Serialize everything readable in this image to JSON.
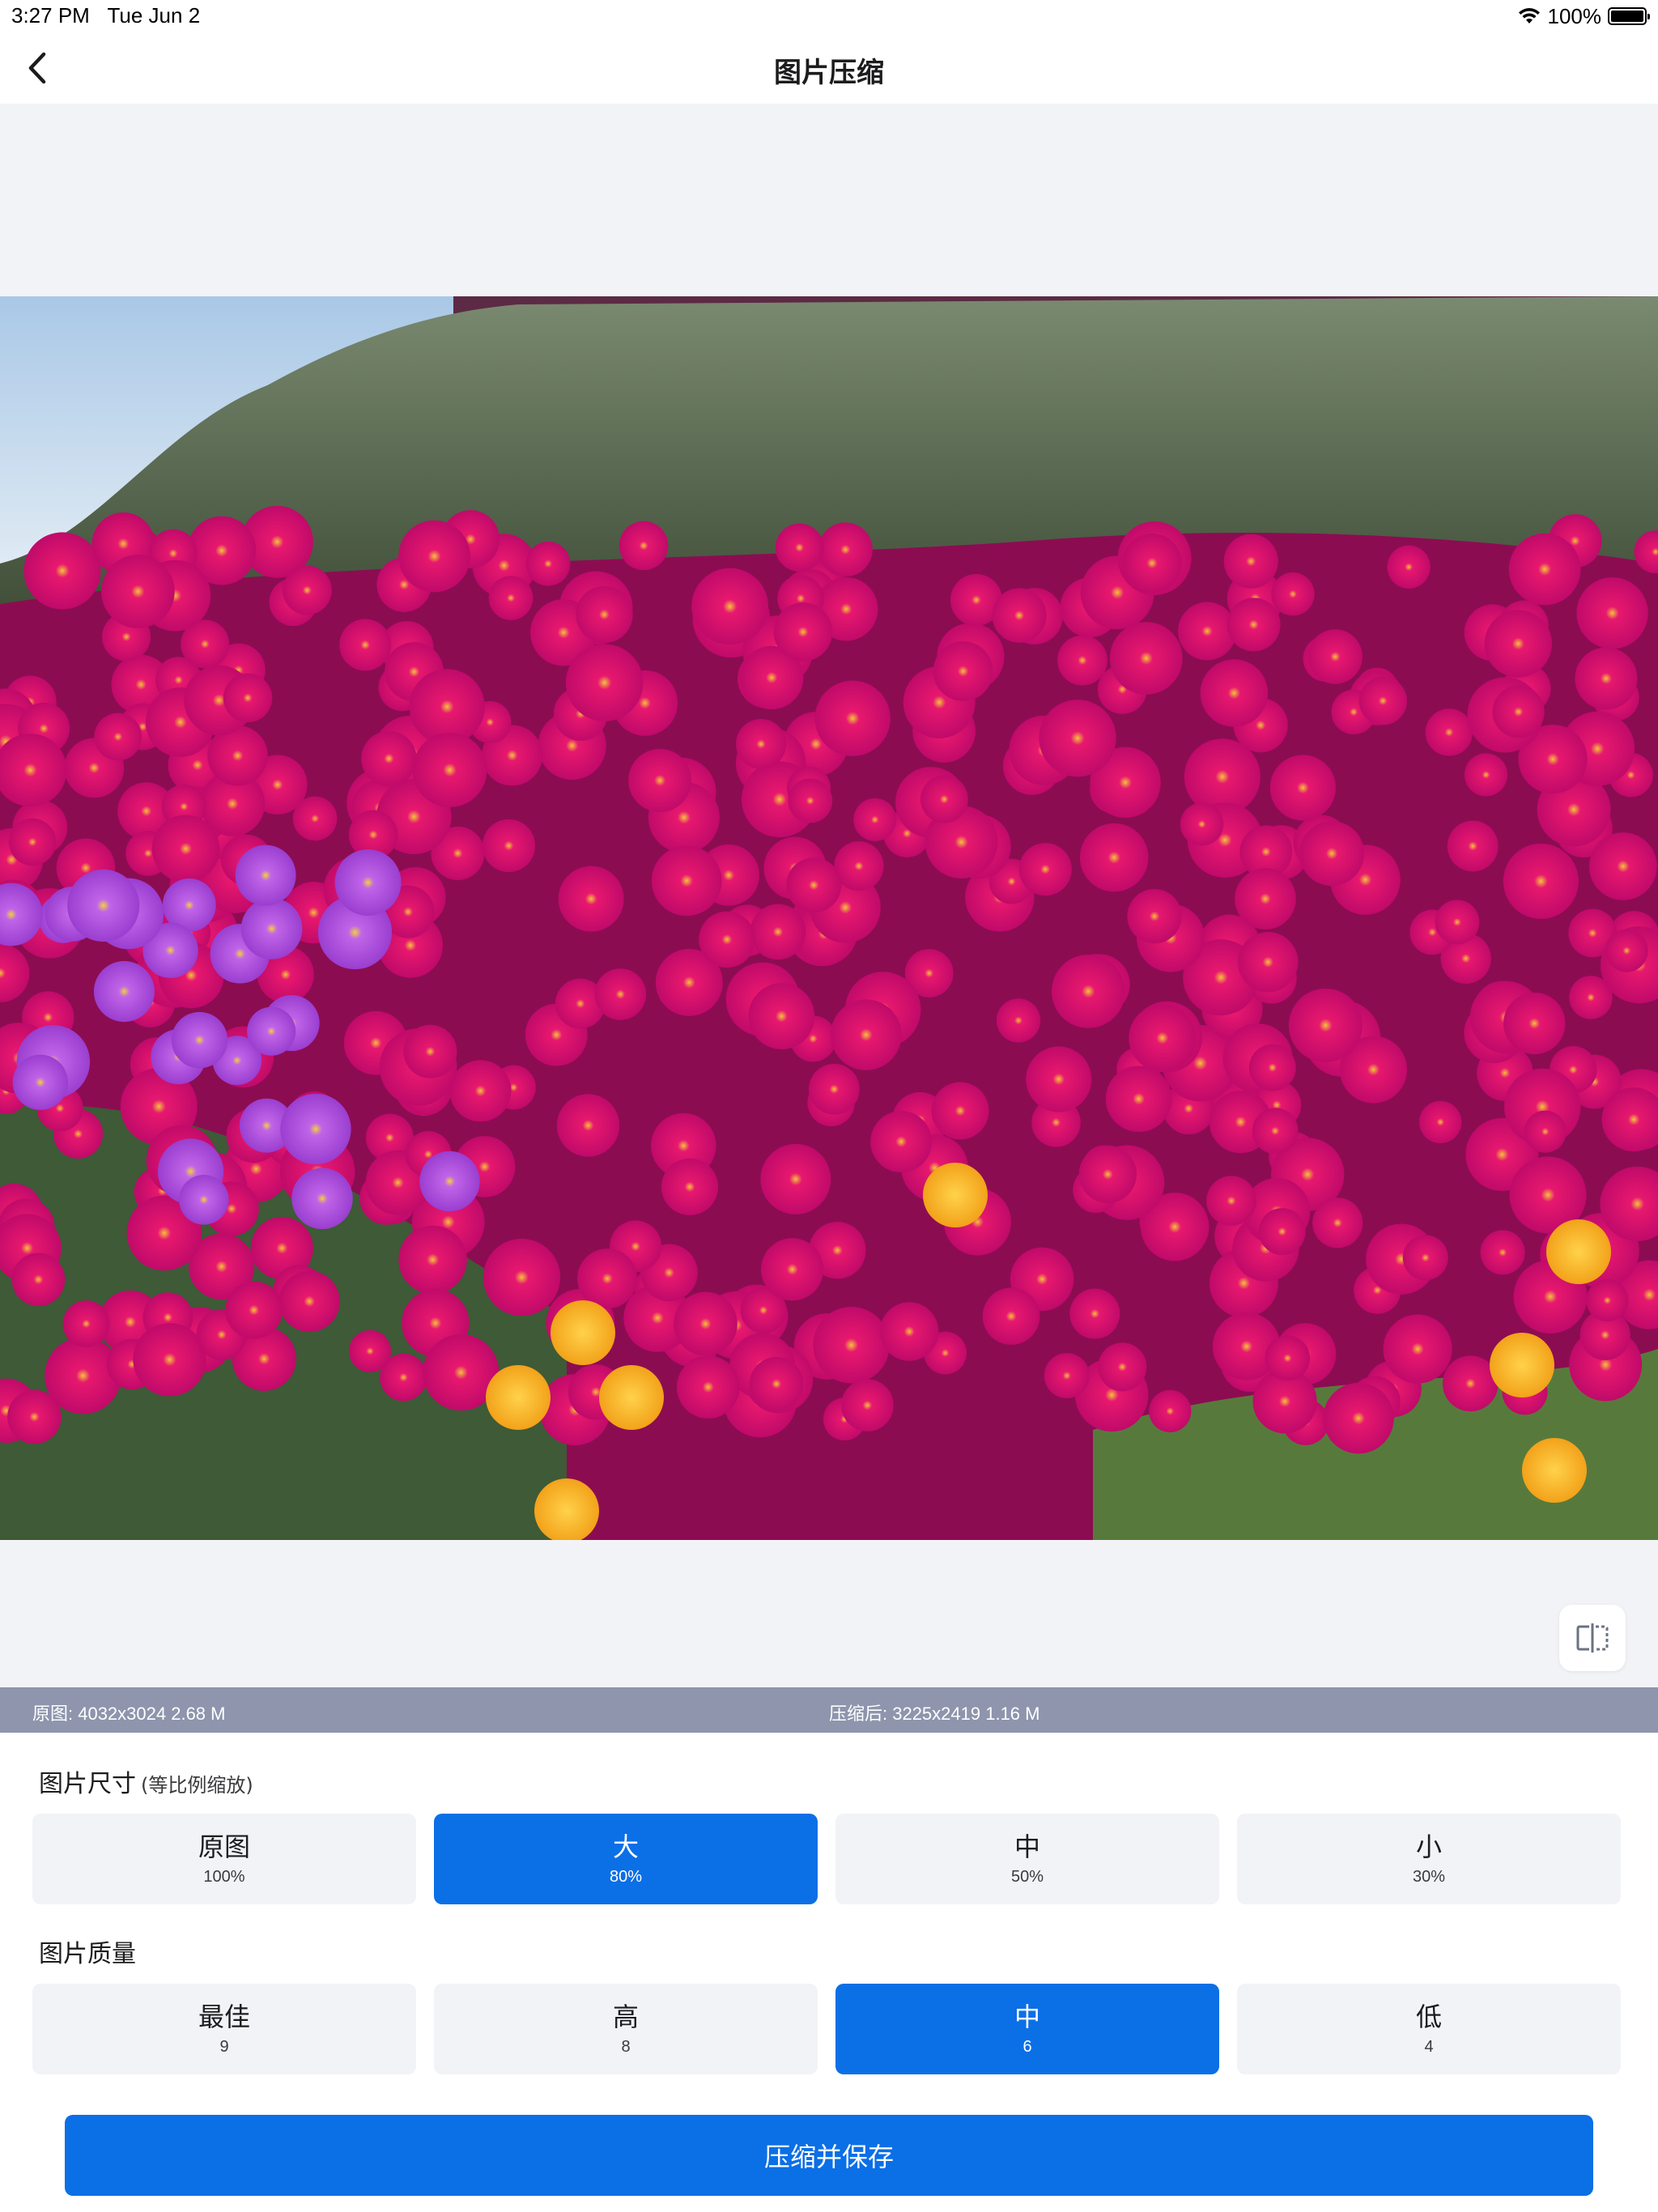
{
  "status_bar": {
    "time": "3:27 PM",
    "date": "Tue Jun 2",
    "battery": "100%"
  },
  "nav": {
    "title": "图片压缩",
    "back_icon": "chevron-left-icon"
  },
  "preview": {
    "compare_icon": "split-compare-icon",
    "photo": "pink and orange ice plant flowers"
  },
  "info": {
    "original": "原图: 4032x3024 2.68 M",
    "compressed": "压缩后: 3225x2419 1.16 M"
  },
  "size_section": {
    "title": "图片尺寸",
    "subtitle": "(等比例缩放)",
    "options": [
      {
        "label": "原图",
        "value": "100%"
      },
      {
        "label": "大",
        "value": "80%"
      },
      {
        "label": "中",
        "value": "50%"
      },
      {
        "label": "小",
        "value": "30%"
      }
    ],
    "selected_index": 1
  },
  "quality_section": {
    "title": "图片质量",
    "options": [
      {
        "label": "最佳",
        "value": "9"
      },
      {
        "label": "高",
        "value": "8"
      },
      {
        "label": "中",
        "value": "6"
      },
      {
        "label": "低",
        "value": "4"
      }
    ],
    "selected_index": 2
  },
  "actions": {
    "save_label": "压缩并保存"
  },
  "colors": {
    "accent": "#0b6fe6",
    "info_bar": "#8e95ad",
    "background": "#f2f3f7"
  }
}
